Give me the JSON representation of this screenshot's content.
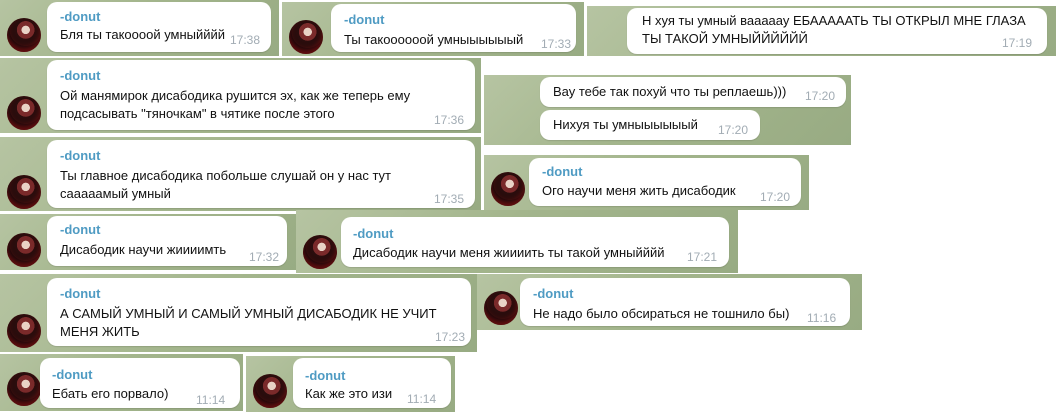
{
  "messages": [
    {
      "sender": "-donut",
      "text": "Бля ты такоооой умныйййй",
      "time": "17:38"
    },
    {
      "sender": "-donut",
      "text": "Ты такоооооой умныыыыыый",
      "time": "17:33"
    },
    {
      "sender": "",
      "text": "Н хуя ты умный вааааау ЕБАААААТЬ ТЫ ОТКРЫЛ МНЕ ГЛАЗА ТЫ ТАКОЙ УМНЫЙЙЙЙЙЙ",
      "time": "17:19"
    },
    {
      "sender": "-donut",
      "text": "Ой манямирок дисабодика рушится эх, как же теперь ему подсасывать \"тяночкам\" в чятике после этого",
      "time": "17:36"
    },
    {
      "sender": "",
      "text": "Вау тебе так похуй что ты реплаешь)))",
      "time": "17:20"
    },
    {
      "sender": "",
      "text": "Нихуя ты умныыыыыый",
      "time": "17:20"
    },
    {
      "sender": "-donut",
      "text": "Ты главное дисабодика побольше слушай он у нас тут сааааамый умный",
      "time": "17:35"
    },
    {
      "sender": "-donut",
      "text": "Ого научи меня жить дисабодик",
      "time": "17:20"
    },
    {
      "sender": "-donut",
      "text": "Дисабодик научи жиииимть",
      "time": "17:32"
    },
    {
      "sender": "-donut",
      "text": "Дисабодик научи меня жиииить ты такой умныйййй",
      "time": "17:21"
    },
    {
      "sender": "-donut",
      "text": "А САМЫЙ УМНЫЙ И САМЫЙ УМНЫЙ ДИСАБОДИК НЕ УЧИТ МЕНЯ ЖИТЬ",
      "time": "17:23"
    },
    {
      "sender": "-donut",
      "text": "Не надо было обсираться не тошнило бы)",
      "time": "11:16"
    },
    {
      "sender": "-donut",
      "text": "Ебать его порвало)",
      "time": "11:14"
    },
    {
      "sender": "-donut",
      "text": "Как же это изи",
      "time": "11:14"
    }
  ]
}
